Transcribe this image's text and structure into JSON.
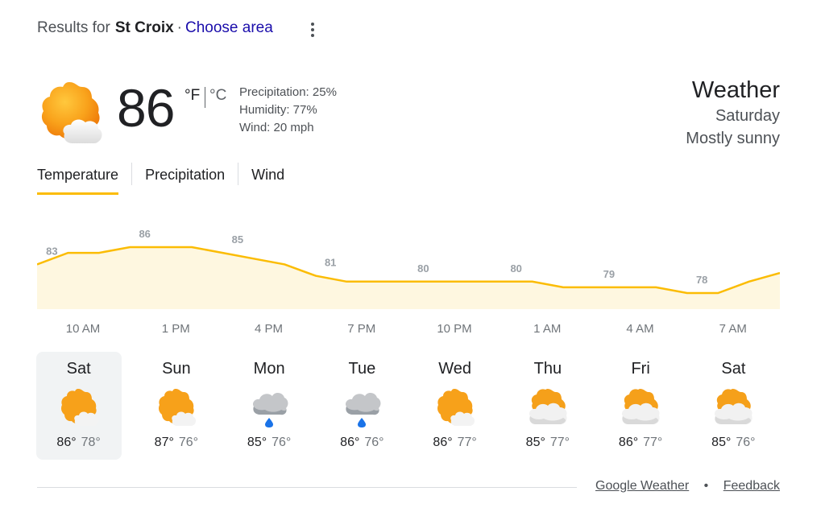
{
  "header": {
    "results_prefix": "Results for",
    "place": "St Croix",
    "separator": "·",
    "choose_area": "Choose area",
    "more_icon": "more-vert-icon"
  },
  "current": {
    "temperature": "86",
    "unit_f": "°F",
    "unit_c": "°C",
    "precipitation": "Precipitation: 25%",
    "humidity": "Humidity: 77%",
    "wind": "Wind: 20 mph",
    "icon": "mostly-sunny-icon"
  },
  "summary": {
    "title": "Weather",
    "day": "Saturday",
    "condition": "Mostly sunny"
  },
  "tabs": [
    {
      "label": "Temperature",
      "active": true
    },
    {
      "label": "Precipitation",
      "active": false
    },
    {
      "label": "Wind",
      "active": false
    }
  ],
  "chart_data": {
    "type": "area",
    "values": [
      83,
      86,
      85,
      81,
      80,
      80,
      79,
      78
    ],
    "value_labels": [
      "83",
      "86",
      "85",
      "81",
      "80",
      "80",
      "79",
      "78"
    ],
    "categories": [
      "10 AM",
      "1 PM",
      "4 PM",
      "7 PM",
      "10 PM",
      "1 AM",
      "4 AM",
      "7 AM"
    ],
    "series_hourly": [
      83,
      85,
      85,
      86,
      86,
      86,
      85,
      84,
      83,
      81,
      80,
      80,
      80,
      80,
      80,
      80,
      80,
      79,
      79,
      79,
      79,
      78,
      78,
      80,
      81.5
    ],
    "ylim": [
      76,
      88
    ],
    "line_color": "#fbbc04",
    "fill_color": "#fef7e0"
  },
  "days": [
    {
      "name": "Sat",
      "hi": "86°",
      "lo": "78°",
      "icon": "mostly-sunny-icon",
      "selected": true
    },
    {
      "name": "Sun",
      "hi": "87°",
      "lo": "76°",
      "icon": "mostly-sunny-icon",
      "selected": false
    },
    {
      "name": "Mon",
      "hi": "85°",
      "lo": "76°",
      "icon": "rain-cloud-icon",
      "selected": false
    },
    {
      "name": "Tue",
      "hi": "86°",
      "lo": "76°",
      "icon": "rain-cloud-icon",
      "selected": false
    },
    {
      "name": "Wed",
      "hi": "86°",
      "lo": "77°",
      "icon": "mostly-sunny-icon",
      "selected": false
    },
    {
      "name": "Thu",
      "hi": "85°",
      "lo": "77°",
      "icon": "partly-cloudy-icon",
      "selected": false
    },
    {
      "name": "Fri",
      "hi": "86°",
      "lo": "77°",
      "icon": "partly-cloudy-icon",
      "selected": false
    },
    {
      "name": "Sat",
      "hi": "85°",
      "lo": "76°",
      "icon": "partly-cloudy-icon",
      "selected": false
    }
  ],
  "footer": {
    "source": "Google Weather",
    "bullet": "•",
    "feedback": "Feedback"
  },
  "colors": {
    "link": "#1a0dab",
    "accent": "#fbbc04",
    "sun_orange": "#f29900",
    "rain_drop": "#1a73e8"
  }
}
